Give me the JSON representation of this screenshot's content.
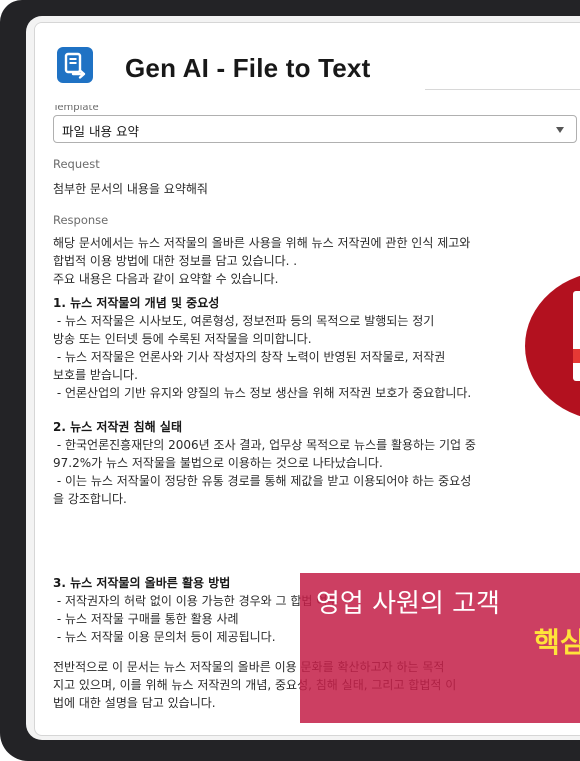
{
  "header": {
    "title": "Gen AI - File to Text",
    "icon": "document-arrow-icon"
  },
  "template": {
    "label": "Template",
    "value": "파일 내용 요약"
  },
  "request": {
    "label": "Request",
    "text": "첨부한 문서의 내용을 요약해줘"
  },
  "response": {
    "label": "Response",
    "intro": "해당 문서에서는 뉴스 저작물의 올바른 사용을 위해 뉴스 저작권에 관한 인식 제고와\n합법적 이용 방법에 대한 정보를 담고 있습니다. .\n주요 내용은 다음과 같이 요약할 수 있습니다.",
    "section1_heading": "1. 뉴스 저작물의 개념 및 중요성",
    "section1_body": " - 뉴스 저작물은 시사보도, 여론형성, 정보전파 등의 목적으로 발행되는 정기\n방송 또는 인터넷 등에 수록된 저작물을 의미합니다.\n - 뉴스 저작물은 언론사와 기사 작성자의 창작 노력이 반영된 저작물로, 저작권\n보호를 받습니다.\n - 언론산업의 기반 유지와 양질의 뉴스 정보 생산을 위해 저작권 보호가 중요합니다.",
    "section2_heading": "2. 뉴스 저작권 침해 실태",
    "section2_body": " - 한국언론진흥재단의 2006년 조사 결과, 업무상 목적으로 뉴스를 활용하는 기업 중\n97.2%가 뉴스 저작물을 불법으로 이용하는 것으로 나타났습니다.\n - 이는 뉴스 저작물이 정당한 유통 경로를 통해 제값을 받고 이용되어야 하는 중요성\n을 강조합니다.",
    "section3_heading": "3. 뉴스 저작물의 올바른 활용 방법",
    "section3_body": " - 저작권자의 허락 없이 이용 가능한 경우와 그 합법 여부\n - 뉴스 저작물 구매를 통한 활용 사례\n - 뉴스 저작물 이용 문의처 등이 제공됩니다.",
    "conclusion": "전반적으로 이 문서는 뉴스 저작물의 올바른 이용 문화를 확산하고자 하는 목적\n지고 있으며, 이를 위해 뉴스 저작권의 개념, 중요성, 침해 실태, 그리고 합법적 이\n법에 대한 설명을 담고 있습니다."
  },
  "overlay": {
    "line1": "영업 사원의 고객",
    "line2": "핵심"
  },
  "colors": {
    "app_icon": "#1f72c4",
    "overlay": "#c42048",
    "highlight": "#ffe33a",
    "badge": "#b3111f"
  }
}
